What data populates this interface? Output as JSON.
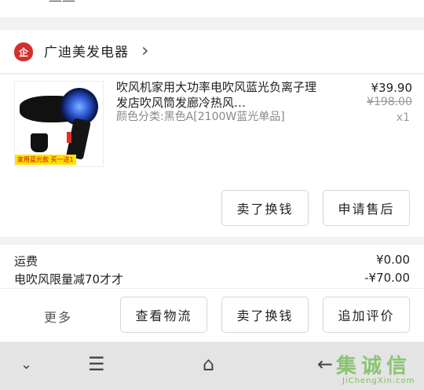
{
  "top": {
    "cut_text": "——"
  },
  "shop": {
    "logo": "企",
    "name": "广迪美发电器",
    "chevron": "›"
  },
  "item": {
    "title": "吹风机家用大功率电吹风蓝光负离子理发店吹风筒发廊冷热风…",
    "variant": "颜色分类:黑色A[2100W蓝光单品]",
    "price": "¥39.90",
    "original_price": "¥198.00",
    "quantity": "x1",
    "thumb_promo": "家用蓝光款 买一送1",
    "sell_button": "卖了换钱",
    "after_sale_button": "申请售后"
  },
  "fees": [
    {
      "label": "运费",
      "value": "¥0.00"
    },
    {
      "label": "电吹风限量减70才才",
      "value": "-¥70.00"
    }
  ],
  "actions": {
    "more": "更多",
    "logistics": "查看物流",
    "sell": "卖了换钱",
    "review": "追加评价"
  },
  "navbar": {
    "collapse_icon": "chevron-down-icon",
    "menu_icon": "menu-icon",
    "home_icon": "home-icon",
    "back_icon": "back-arrow-icon",
    "watermark_big": "集诚信",
    "watermark_small": "JiChengXin.com"
  },
  "colors": {
    "shop_logo": "#d32f2f",
    "watermark": "#7bbf5f"
  }
}
